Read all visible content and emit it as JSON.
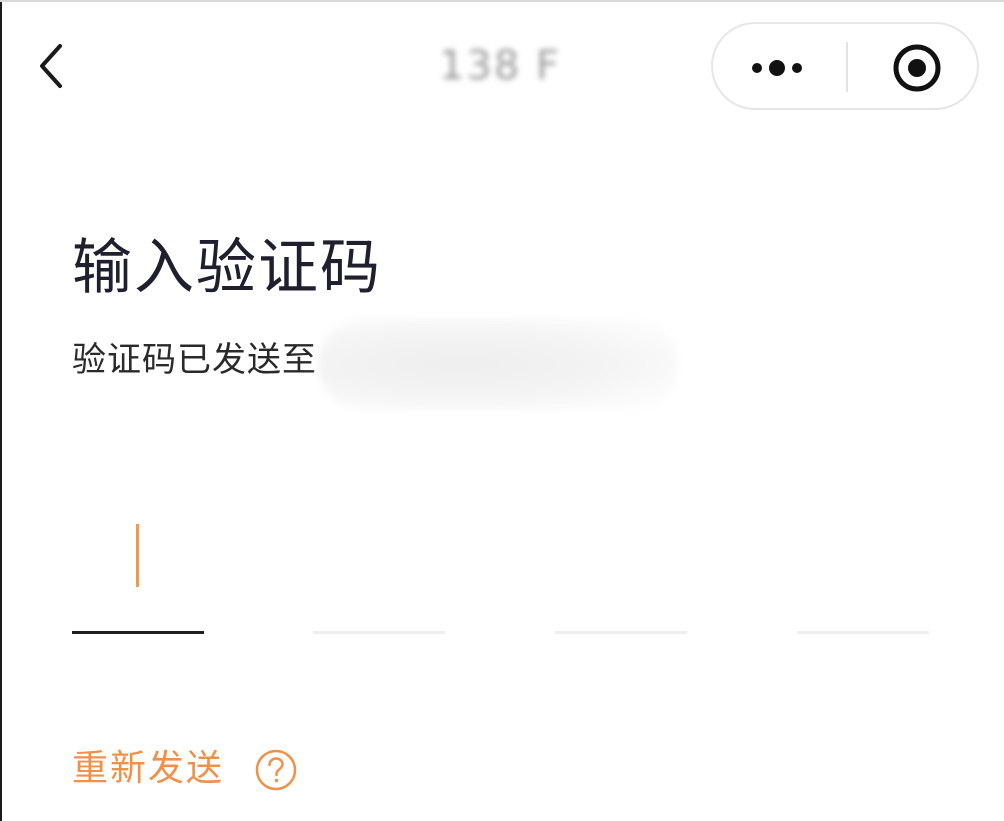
{
  "nav": {
    "title": "138 F",
    "back_icon": "chevron-left-icon",
    "more_icon": "more-dots-icon",
    "close_icon": "target-close-icon"
  },
  "main": {
    "title": "输入验证码",
    "subtitle": "验证码已发送至",
    "code_inputs": [
      {
        "value": "",
        "active": true
      },
      {
        "value": "",
        "active": false
      },
      {
        "value": "",
        "active": false
      },
      {
        "value": "",
        "active": false
      }
    ],
    "resend_label": "重新发送",
    "help_icon": "question-circle-icon"
  },
  "colors": {
    "accent": "#f0914a",
    "title_text": "#1f1f2e",
    "active_underline": "#1f1f1f",
    "inactive_underline": "#eeeeee"
  }
}
